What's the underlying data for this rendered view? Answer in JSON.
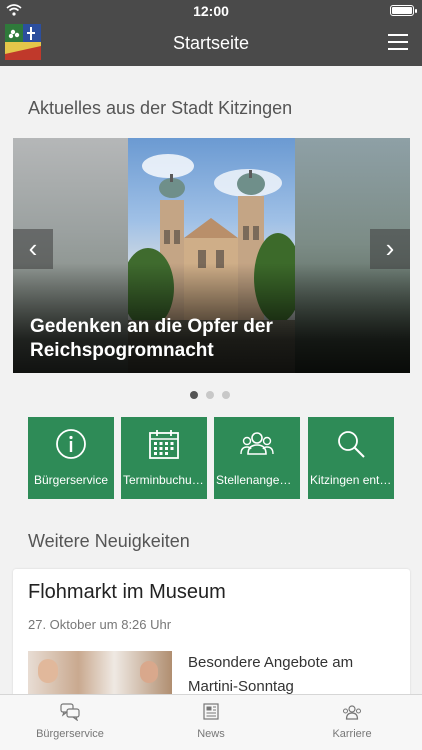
{
  "status_bar": {
    "time": "12:00"
  },
  "nav": {
    "title": "Startseite",
    "logo_icon": "city-coat-of-arms-logo",
    "menu_icon": "hamburger-menu-icon"
  },
  "news_section": {
    "title": "Aktuelles aus der Stadt Kitzingen",
    "carousel": {
      "caption": "Gedenken an die Opfer der Reichspogromnacht",
      "prev_icon": "chevron-left-icon",
      "next_icon": "chevron-right-icon",
      "page_count": 3,
      "active_page": 1
    }
  },
  "quick_tiles": [
    {
      "label": "Bürgerservice",
      "icon": "info-icon"
    },
    {
      "label": "Terminbuchung",
      "icon": "calendar-icon"
    },
    {
      "label": "Stellenangebote",
      "icon": "people-icon"
    },
    {
      "label": "Kitzingen entdecken",
      "icon": "search-icon"
    }
  ],
  "more_news": {
    "title": "Weitere Neuigkeiten",
    "card": {
      "title": "Flohmarkt im Museum",
      "date": "27. Oktober um 8:26 Uhr",
      "teaser": "Besondere Angebote am Martini-Sonntag"
    }
  },
  "tab_bar": [
    {
      "label": "Bürgerservice",
      "icon": "chat-bubbles-icon"
    },
    {
      "label": "News",
      "icon": "newspaper-icon"
    },
    {
      "label": "Karriere",
      "icon": "people-icon"
    }
  ],
  "colors": {
    "nav_bg": "#4a4a4a",
    "tile_green": "#2e8b57",
    "page_bg": "#f2f2f2"
  }
}
